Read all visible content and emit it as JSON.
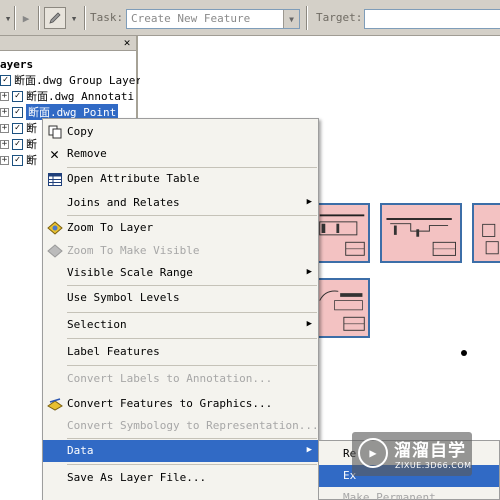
{
  "toolbar": {
    "task_label": "Task:",
    "task_value": "Create New Feature",
    "target_label": "Target:",
    "target_value": ""
  },
  "toc": {
    "title_partial": "ayers",
    "layers": [
      {
        "label": "断面.dwg Group Layer",
        "checked": true
      },
      {
        "label": "断面.dwg Annotati",
        "checked": true
      },
      {
        "label": "断面.dwg Point",
        "checked": true,
        "selected": true
      },
      {
        "label": "断",
        "checked": true
      },
      {
        "label": "断",
        "checked": true
      },
      {
        "label": "断",
        "checked": true
      }
    ]
  },
  "context_menu": {
    "items": [
      {
        "label": "Copy",
        "icon": "copy-icon",
        "enabled": true
      },
      {
        "label": "Remove",
        "icon": "remove-x-icon",
        "enabled": true
      },
      {
        "label": "Open Attribute Table",
        "icon": "table-icon",
        "enabled": true
      },
      {
        "label": "Joins and Relates",
        "enabled": true,
        "submenu": true
      },
      {
        "label": "Zoom To Layer",
        "icon": "zoom-to-layer-icon",
        "enabled": true
      },
      {
        "label": "Zoom To Make Visible",
        "icon": "zoom-visible-icon",
        "enabled": false
      },
      {
        "label": "Visible Scale Range",
        "enabled": true,
        "submenu": true
      },
      {
        "label": "Use Symbol Levels",
        "enabled": true
      },
      {
        "label": "Selection",
        "enabled": true,
        "submenu": true
      },
      {
        "label": "Label Features",
        "enabled": true
      },
      {
        "label": "Convert Labels to Annotation...",
        "enabled": false
      },
      {
        "label": "Convert Features to Graphics...",
        "icon": "convert-graphics-icon",
        "enabled": true
      },
      {
        "label": "Convert Symbology to Representation...",
        "enabled": false
      },
      {
        "label": "Data",
        "enabled": true,
        "submenu": true,
        "highlighted": true
      },
      {
        "label": "Save As Layer File...",
        "enabled": true
      }
    ]
  },
  "submenu": {
    "items": [
      {
        "label": "Re",
        "enabled": true
      },
      {
        "label": "Ex",
        "enabled": true,
        "highlighted": true
      },
      {
        "label": "Make Permanent",
        "enabled": false
      }
    ]
  },
  "watermark": {
    "title": "溜溜自学",
    "subtitle": "ZIXUE.3D66.COM"
  },
  "colors": {
    "toolbar_bg": "#d4d0c8",
    "highlight": "#316ac5",
    "menu_bg": "#f4f3ee",
    "sheet_fill": "#f3c2c2",
    "sheet_border": "#3c6ea8",
    "disabled_text": "#a7a7a7"
  }
}
